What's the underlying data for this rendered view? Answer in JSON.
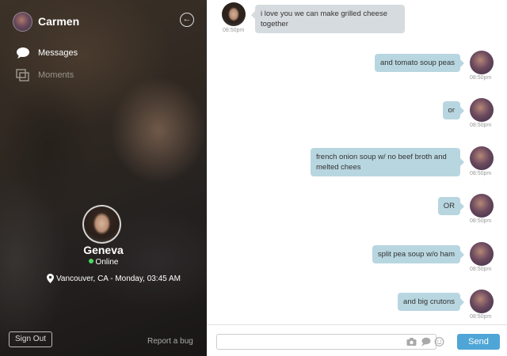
{
  "sidebar": {
    "user_name": "Carmen",
    "nav": [
      {
        "label": "Messages",
        "icon": "chat-bubble-icon",
        "active": true
      },
      {
        "label": "Moments",
        "icon": "moments-icon",
        "active": false
      }
    ],
    "contact": {
      "name": "Geneva",
      "status": "Online",
      "status_color": "#4cd964",
      "location": "Vancouver, CA - Monday, 03:45 AM"
    },
    "sign_out_label": "Sign Out",
    "report_bug_label": "Report a bug"
  },
  "chat": {
    "messages": [
      {
        "direction": "received",
        "text": "i love you we can make grilled cheese together",
        "time": "08:50pm"
      },
      {
        "direction": "sent",
        "text": "and tomato soup peas",
        "time": "08:50pm"
      },
      {
        "direction": "sent",
        "text": "or",
        "time": "08:50pm"
      },
      {
        "direction": "sent",
        "text": "french onion soup w/ no beef broth and melted chees",
        "time": "08:50pm"
      },
      {
        "direction": "sent",
        "text": "OR",
        "time": "08:50pm"
      },
      {
        "direction": "sent",
        "text": "split pea soup w/o ham",
        "time": "08:50pm"
      },
      {
        "direction": "sent",
        "text": "and big crutons",
        "time": "08:50pm"
      }
    ],
    "composer": {
      "input_value": "",
      "input_placeholder": "",
      "send_label": "Send"
    }
  },
  "colors": {
    "sent_bubble": "#b8d6e0",
    "received_bubble": "#d6dbdf",
    "send_button": "#4fa6d6"
  }
}
